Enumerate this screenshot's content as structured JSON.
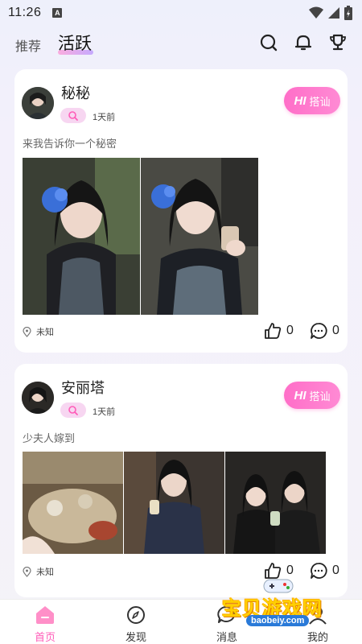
{
  "status_bar": {
    "time": "11:26",
    "notify_glyph": "A"
  },
  "top_nav": {
    "tab_recommend": "推荐",
    "tab_active": "活跃"
  },
  "posts": [
    {
      "username": "秘秘",
      "time_ago": "1天前",
      "hi_text": "HI",
      "hi_label": "搭讪",
      "text": "来我告诉你一个秘密",
      "location": "未知",
      "likes": "0",
      "comments": "0"
    },
    {
      "username": "安丽塔",
      "time_ago": "1天前",
      "hi_text": "HI",
      "hi_label": "搭讪",
      "text": "少夫人嫁到",
      "location": "未知",
      "likes": "0",
      "comments": "0"
    }
  ],
  "bottom_nav": {
    "home": "首页",
    "discover": "发现",
    "messages": "消息",
    "mine": "我的"
  },
  "watermark": {
    "title": "宝贝游戏网",
    "url": "baobeiy.com"
  },
  "colors": {
    "accent": "#ff5cb8",
    "hi_gradient_start": "#ff6ec8",
    "hi_gradient_end": "#ff8ad4"
  }
}
